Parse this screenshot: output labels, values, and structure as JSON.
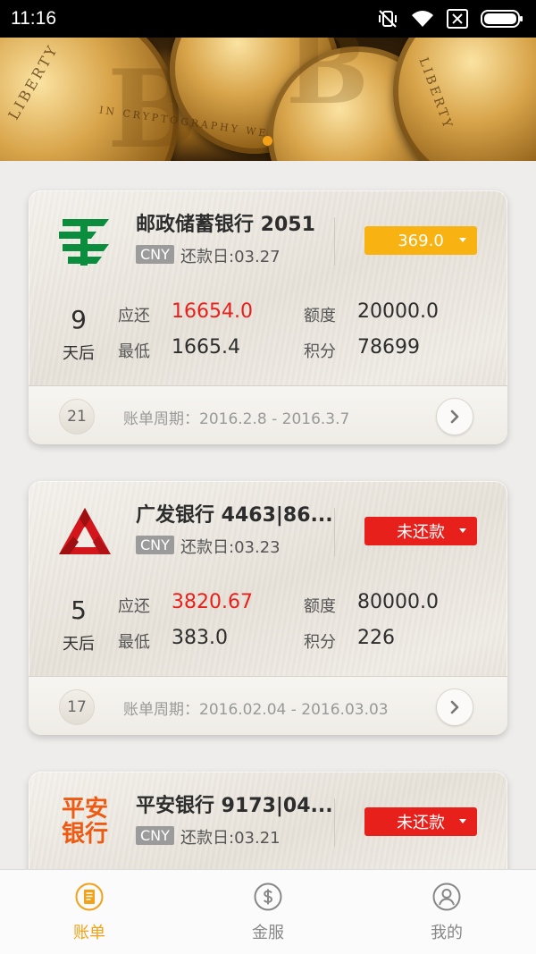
{
  "status_bar": {
    "time": "11:16",
    "icons": [
      "vibrate-off-icon",
      "wifi-icon",
      "no-sim-icon",
      "battery-icon"
    ]
  },
  "banner": {
    "coin_symbol": "B",
    "coin_text_1": "LIBERTY",
    "coin_text_2": "IN CRYPTOGRAPHY WE TRUST"
  },
  "cards": [
    {
      "bank_name": "邮政储蓄银行 2051",
      "logo": "postal-savings-bank-logo",
      "currency": "CNY",
      "due_date": "还款日:03.27",
      "status_label": "369.0",
      "status_color": "#f8b312",
      "days_num": "9",
      "days_label": "天后",
      "due_label": "应还",
      "due_value": "16654.0",
      "min_label": "最低",
      "min_value": "1665.4",
      "limit_label": "额度",
      "limit_value": "20000.0",
      "points_label": "积分",
      "points_value": "78699",
      "cycle_day": "21",
      "cycle_text": "账单周期：2016.2.8 - 2016.3.7"
    },
    {
      "bank_name": "广发银行 4463|86...",
      "logo": "guangfa-bank-logo",
      "currency": "CNY",
      "due_date": "还款日:03.23",
      "status_label": "未还款",
      "status_color": "#e8201b",
      "days_num": "5",
      "days_label": "天后",
      "due_label": "应还",
      "due_value": "3820.67",
      "min_label": "最低",
      "min_value": "383.0",
      "limit_label": "额度",
      "limit_value": "80000.0",
      "points_label": "积分",
      "points_value": "226",
      "cycle_day": "17",
      "cycle_text": "账单周期：2016.02.04 - 2016.03.03"
    },
    {
      "bank_name": "平安银行 9173|04...",
      "logo": "pingan-bank-logo",
      "logo_text_1": "平安",
      "logo_text_2": "银行",
      "currency": "CNY",
      "due_date": "还款日:03.21",
      "status_label": "未还款",
      "status_color": "#e8201b"
    }
  ],
  "bottom_nav": [
    {
      "label": "账单",
      "icon": "bill-icon",
      "active": true
    },
    {
      "label": "金服",
      "icon": "finance-icon",
      "active": false
    },
    {
      "label": "我的",
      "icon": "profile-icon",
      "active": false
    }
  ],
  "colors": {
    "accent": "#f3a117",
    "red": "#e8201b",
    "gold_button": "#f8b312"
  }
}
